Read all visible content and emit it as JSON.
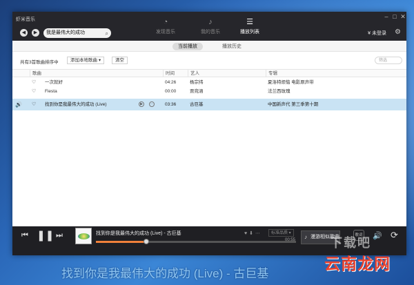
{
  "window": {
    "app_title": "虾米音乐"
  },
  "header": {
    "search_value": "我是最伟大的成功",
    "tabs": [
      {
        "label": "发现音乐",
        "icon": "compass-icon"
      },
      {
        "label": "我的音乐",
        "icon": "music-note-icon"
      },
      {
        "label": "播放列表",
        "icon": "playlist-icon",
        "active": true
      }
    ],
    "login_label": "未登录",
    "window_controls": [
      "minimize",
      "maximize",
      "close"
    ]
  },
  "subtabs": [
    {
      "label": "当前播放",
      "active": true
    },
    {
      "label": "播放历史",
      "active": false
    }
  ],
  "toolbar": {
    "count_text": "共有3首歌曲排序中",
    "add_local_label": "添加本地歌曲",
    "clear_label": "清空",
    "filter_placeholder": "筛选"
  },
  "table": {
    "columns": [
      "歌曲",
      "时间",
      "艺人",
      "专辑"
    ],
    "rows": [
      {
        "title": "一次就好",
        "time": "04:26",
        "artist": "杨宗纬",
        "album": "夏洛特烦恼 电影原声带",
        "playing": false
      },
      {
        "title": "Fiesta",
        "time": "00:00",
        "artist": "贾宛涵",
        "album": "法兰西玫瑰",
        "playing": false
      },
      {
        "title": "找到你是我最伟大的成功 (Live)",
        "time": "03:36",
        "artist": "古巨基",
        "album": "中国新声代 第三季第十期",
        "playing": true
      }
    ]
  },
  "player": {
    "now_playing": "找到你是我最伟大的成功 (Live) - 古巨基",
    "quality_label": "标准品质",
    "elapsed": "00:55",
    "progress_fraction": 0.25,
    "radio_label": "漫游相似歌曲",
    "lyric_button": "歌词"
  },
  "desktop_lyric": "找到你是我最伟大的成功 (Live) - 古巨基",
  "watermark": {
    "text": "云南龙网",
    "color": "#e8422e"
  },
  "colors": {
    "titlebar": "#26262b",
    "highlight_row": "#c9e3f4",
    "progress": "#f0803a"
  }
}
